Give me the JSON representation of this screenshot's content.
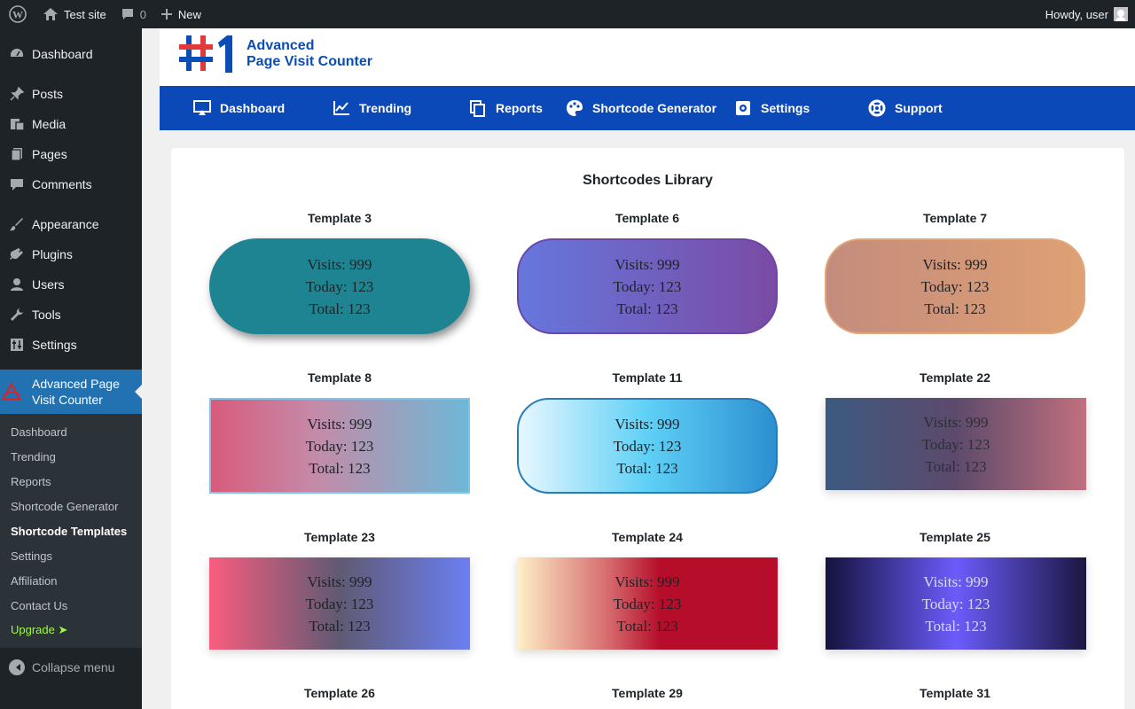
{
  "adminbar": {
    "site_name": "Test site",
    "comments_count": "0",
    "new_label": "New",
    "greeting": "Howdy, user"
  },
  "sidebar": {
    "items": [
      {
        "label": "Dashboard",
        "icon": "dashboard-icon"
      },
      {
        "label": "Posts",
        "icon": "pin-icon"
      },
      {
        "label": "Media",
        "icon": "media-icon"
      },
      {
        "label": "Pages",
        "icon": "pages-icon"
      },
      {
        "label": "Comments",
        "icon": "comment-icon"
      },
      {
        "label": "Appearance",
        "icon": "brush-icon"
      },
      {
        "label": "Plugins",
        "icon": "plug-icon"
      },
      {
        "label": "Users",
        "icon": "user-icon"
      },
      {
        "label": "Tools",
        "icon": "wrench-icon"
      },
      {
        "label": "Settings",
        "icon": "settings-icon"
      }
    ],
    "active": {
      "label_line1": "Advanced Page",
      "label_line2": "Visit Counter"
    },
    "submenu": [
      "Dashboard",
      "Trending",
      "Reports",
      "Shortcode Generator",
      "Shortcode Templates",
      "Settings",
      "Affiliation",
      "Contact Us",
      "Upgrade ➤"
    ],
    "current_sub": "Shortcode Templates",
    "collapse_label": "Collapse menu"
  },
  "plugin": {
    "brand_line1": "Advanced",
    "brand_line2": "Page Visit Counter",
    "nav": [
      "Dashboard",
      "Trending",
      "Reports",
      "Shortcode Generator",
      "Settings",
      "Support"
    ]
  },
  "library": {
    "title": "Shortcodes Library",
    "templates": [
      {
        "name": "Template 3",
        "visits": "Visits: 999",
        "today": "Today: 123",
        "total": "Total: 123"
      },
      {
        "name": "Template 6",
        "visits": "Visits: 999",
        "today": "Today: 123",
        "total": "Total: 123"
      },
      {
        "name": "Template 7",
        "visits": "Visits: 999",
        "today": "Today: 123",
        "total": "Total: 123"
      },
      {
        "name": "Template 8",
        "visits": "Visits: 999",
        "today": "Today: 123",
        "total": "Total: 123"
      },
      {
        "name": "Template 11",
        "visits": "Visits: 999",
        "today": "Today: 123",
        "total": "Total: 123"
      },
      {
        "name": "Template 22",
        "visits": "Visits: 999",
        "today": "Today: 123",
        "total": "Total: 123"
      },
      {
        "name": "Template 23",
        "visits": "Visits: 999",
        "today": "Today: 123",
        "total": "Total: 123"
      },
      {
        "name": "Template 24",
        "visits": "Visits: 999",
        "today": "Today: 123",
        "total": "Total: 123"
      },
      {
        "name": "Template 25",
        "visits": "Visits: 999",
        "today": "Today: 123",
        "total": "Total: 123"
      },
      {
        "name": "Template 26"
      },
      {
        "name": "Template 29"
      },
      {
        "name": "Template 31"
      }
    ]
  },
  "colors": {
    "admin_bg": "#1d2327",
    "active_menu": "#2271b1",
    "plugin_nav": "#0b49b9",
    "upgrade": "#9cfb3b"
  }
}
